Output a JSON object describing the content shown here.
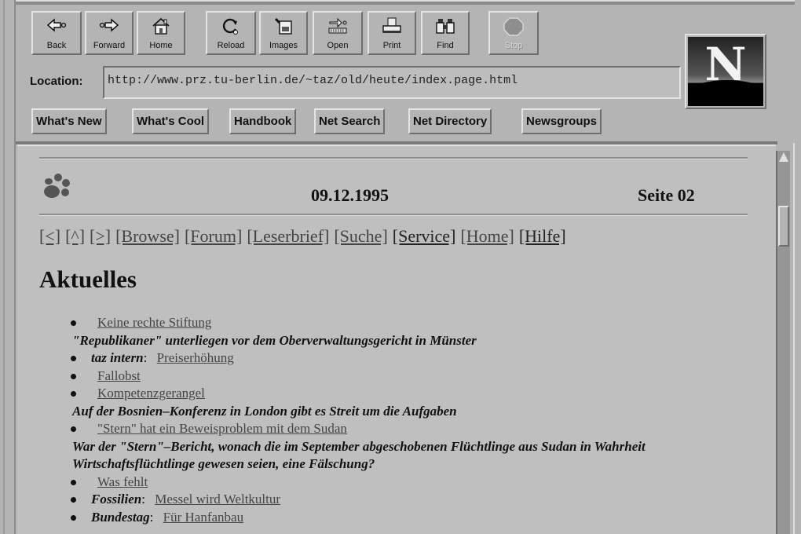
{
  "toolbar": {
    "buttons": [
      {
        "label": "Back",
        "icon": "back-arrow-icon"
      },
      {
        "label": "Forward",
        "icon": "forward-arrow-icon"
      },
      {
        "label": "Home",
        "icon": "home-icon"
      },
      {
        "label": "Reload",
        "icon": "reload-icon"
      },
      {
        "label": "Images",
        "icon": "images-icon"
      },
      {
        "label": "Open",
        "icon": "open-icon"
      },
      {
        "label": "Print",
        "icon": "print-icon"
      },
      {
        "label": "Find",
        "icon": "binoculars-icon"
      },
      {
        "label": "Stop",
        "icon": "stop-icon",
        "disabled": true
      }
    ]
  },
  "logo": {
    "letter": "N"
  },
  "location": {
    "label": "Location:",
    "url": "http://www.prz.tu-berlin.de/~taz/old/heute/index.page.html"
  },
  "directory_buttons": [
    "What's New",
    "What's Cool",
    "Handbook",
    "Net Search",
    "Net Directory",
    "Newsgroups"
  ],
  "page": {
    "date": "09.12.1995",
    "page_number": "Seite 02",
    "nav_links": [
      "[<]",
      "[^]",
      "[>]",
      "[Browse]",
      "[Forum]",
      "[Leserbrief]",
      "[Suche]",
      "[Service]",
      "[Home]",
      "[Hilfe]"
    ],
    "heading": "Aktuelles",
    "news": [
      {
        "category": "",
        "link": "Keine rechte Stiftung",
        "description": "\"Republikaner\" unterliegen vor dem Oberverwaltungsgericht in Münster"
      },
      {
        "category": "taz intern",
        "link": "Preiserhöhung",
        "description": ""
      },
      {
        "category": "",
        "link": "Fallobst",
        "description": ""
      },
      {
        "category": "",
        "link": "Kompetenzgerangel",
        "description": "Auf der Bosnien–Konferenz in London gibt es Streit um die Aufgaben"
      },
      {
        "category": "",
        "link": "\"Stern\" hat ein Beweisproblem mit dem Sudan",
        "description": "War der \"Stern\"–Bericht, wonach die im September abgeschobenen Flüchtlinge aus Sudan in Wahrheit Wirtschaftsflüchtlinge gewesen seien, eine Fälschung?"
      },
      {
        "category": "",
        "link": "Was fehlt",
        "description": ""
      },
      {
        "category": "Fossilien",
        "link": "Messel wird Weltkultur",
        "description": ""
      },
      {
        "category": "Bundestag",
        "link": "Für Hanfanbau",
        "description": ""
      }
    ]
  },
  "scrollbar": {
    "position_fraction": 0.12
  }
}
